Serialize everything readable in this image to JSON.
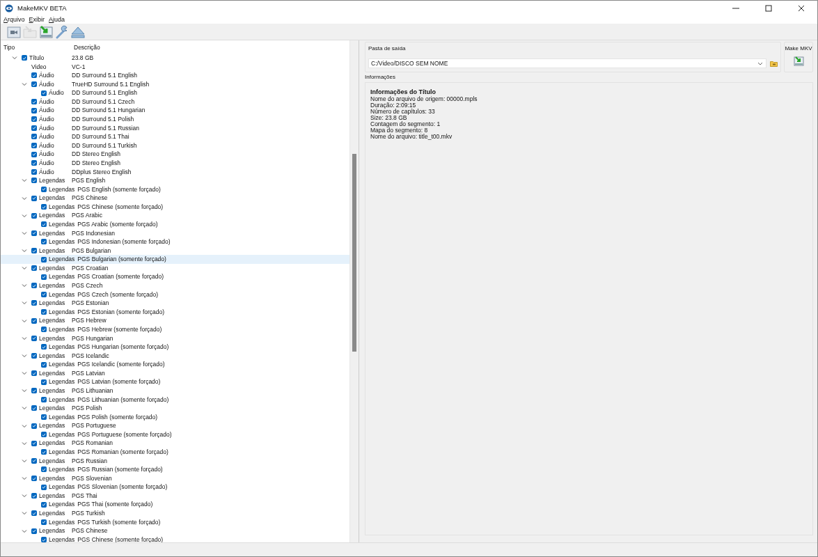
{
  "window": {
    "title": "MakeMKV BETA"
  },
  "menu": [
    {
      "label": "Arquivo"
    },
    {
      "label": "Exibir"
    },
    {
      "label": "Ajuda"
    }
  ],
  "toolbar": [
    {
      "kind": "video",
      "disabled": false
    },
    {
      "kind": "disc",
      "disabled": true
    },
    {
      "kind": "make",
      "disabled": false
    },
    {
      "kind": "wrench",
      "disabled": false
    },
    {
      "kind": "eject",
      "disabled": false
    }
  ],
  "tree": {
    "columns": [
      "Tipo",
      "Descrição"
    ],
    "items": [
      {
        "type": "Título",
        "description": "23.8 GB",
        "kind": "checkbox",
        "checked": true,
        "selected": false,
        "expanded": true,
        "children": [
          {
            "type": "Video",
            "description": "VC-1",
            "kind": "plain",
            "selected": false
          },
          {
            "type": "Áudio",
            "description": "DD Surround 5.1 English",
            "kind": "checkbox",
            "checked": true,
            "selected": false
          },
          {
            "type": "Áudio",
            "description": "TrueHD Surround 5.1 English",
            "kind": "checkbox",
            "checked": true,
            "selected": false,
            "expanded": true,
            "children": [
              {
                "type": "Áudio",
                "description": "DD Surround 5.1 English",
                "kind": "checkbox",
                "checked": true,
                "selected": false
              }
            ]
          },
          {
            "type": "Áudio",
            "description": "DD Surround 5.1 Czech",
            "kind": "checkbox",
            "checked": true,
            "selected": false
          },
          {
            "type": "Áudio",
            "description": "DD Surround 5.1 Hungarian",
            "kind": "checkbox",
            "checked": true,
            "selected": false
          },
          {
            "type": "Áudio",
            "description": "DD Surround 5.1 Polish",
            "kind": "checkbox",
            "checked": true,
            "selected": false
          },
          {
            "type": "Áudio",
            "description": "DD Surround 5.1 Russian",
            "kind": "checkbox",
            "checked": true,
            "selected": false
          },
          {
            "type": "Áudio",
            "description": "DD Surround 5.1 Thai",
            "kind": "checkbox",
            "checked": true,
            "selected": false
          },
          {
            "type": "Áudio",
            "description": "DD Surround 5.1 Turkish",
            "kind": "checkbox",
            "checked": true,
            "selected": false
          },
          {
            "type": "Áudio",
            "description": "DD Stereo English",
            "kind": "checkbox",
            "checked": true,
            "selected": false
          },
          {
            "type": "Áudio",
            "description": "DD Stereo English",
            "kind": "checkbox",
            "checked": true,
            "selected": false
          },
          {
            "type": "Áudio",
            "description": "DDplus Stereo English",
            "kind": "checkbox",
            "checked": true,
            "selected": false
          },
          {
            "type": "Legendas",
            "description": "PGS English",
            "kind": "checkbox",
            "checked": true,
            "selected": false,
            "expanded": true,
            "children": [
              {
                "type": "Legendas",
                "description": "PGS English (somente forçado)",
                "kind": "checkbox",
                "checked": true,
                "selected": false
              }
            ]
          },
          {
            "type": "Legendas",
            "description": "PGS Chinese",
            "kind": "checkbox",
            "checked": true,
            "selected": false,
            "expanded": true,
            "children": [
              {
                "type": "Legendas",
                "description": "PGS Chinese (somente forçado)",
                "kind": "checkbox",
                "checked": true,
                "selected": false
              }
            ]
          },
          {
            "type": "Legendas",
            "description": "PGS Arabic",
            "kind": "checkbox",
            "checked": true,
            "selected": false,
            "expanded": true,
            "children": [
              {
                "type": "Legendas",
                "description": "PGS Arabic (somente forçado)",
                "kind": "checkbox",
                "checked": true,
                "selected": false
              }
            ]
          },
          {
            "type": "Legendas",
            "description": "PGS Indonesian",
            "kind": "checkbox",
            "checked": true,
            "selected": false,
            "expanded": true,
            "children": [
              {
                "type": "Legendas",
                "description": "PGS Indonesian (somente forçado)",
                "kind": "checkbox",
                "checked": true,
                "selected": false
              }
            ]
          },
          {
            "type": "Legendas",
            "description": "PGS Bulgarian",
            "kind": "checkbox",
            "checked": true,
            "selected": false,
            "expanded": true,
            "children": [
              {
                "type": "Legendas",
                "description": "PGS Bulgarian (somente forçado)",
                "kind": "checkbox",
                "checked": true,
                "selected": true
              }
            ]
          },
          {
            "type": "Legendas",
            "description": "PGS Croatian",
            "kind": "checkbox",
            "checked": true,
            "selected": false,
            "expanded": true,
            "children": [
              {
                "type": "Legendas",
                "description": "PGS Croatian (somente forçado)",
                "kind": "checkbox",
                "checked": true,
                "selected": false
              }
            ]
          },
          {
            "type": "Legendas",
            "description": "PGS Czech",
            "kind": "checkbox",
            "checked": true,
            "selected": false,
            "expanded": true,
            "children": [
              {
                "type": "Legendas",
                "description": "PGS Czech (somente forçado)",
                "kind": "checkbox",
                "checked": true,
                "selected": false
              }
            ]
          },
          {
            "type": "Legendas",
            "description": "PGS Estonian",
            "kind": "checkbox",
            "checked": true,
            "selected": false,
            "expanded": true,
            "children": [
              {
                "type": "Legendas",
                "description": "PGS Estonian (somente forçado)",
                "kind": "checkbox",
                "checked": true,
                "selected": false
              }
            ]
          },
          {
            "type": "Legendas",
            "description": "PGS Hebrew",
            "kind": "checkbox",
            "checked": true,
            "selected": false,
            "expanded": true,
            "children": [
              {
                "type": "Legendas",
                "description": "PGS Hebrew (somente forçado)",
                "kind": "checkbox",
                "checked": true,
                "selected": false
              }
            ]
          },
          {
            "type": "Legendas",
            "description": "PGS Hungarian",
            "kind": "checkbox",
            "checked": true,
            "selected": false,
            "expanded": true,
            "children": [
              {
                "type": "Legendas",
                "description": "PGS Hungarian (somente forçado)",
                "kind": "checkbox",
                "checked": true,
                "selected": false
              }
            ]
          },
          {
            "type": "Legendas",
            "description": "PGS Icelandic",
            "kind": "checkbox",
            "checked": true,
            "selected": false,
            "expanded": true,
            "children": [
              {
                "type": "Legendas",
                "description": "PGS Icelandic (somente forçado)",
                "kind": "checkbox",
                "checked": true,
                "selected": false
              }
            ]
          },
          {
            "type": "Legendas",
            "description": "PGS Latvian",
            "kind": "checkbox",
            "checked": true,
            "selected": false,
            "expanded": true,
            "children": [
              {
                "type": "Legendas",
                "description": "PGS Latvian (somente forçado)",
                "kind": "checkbox",
                "checked": true,
                "selected": false
              }
            ]
          },
          {
            "type": "Legendas",
            "description": "PGS Lithuanian",
            "kind": "checkbox",
            "checked": true,
            "selected": false,
            "expanded": true,
            "children": [
              {
                "type": "Legendas",
                "description": "PGS Lithuanian (somente forçado)",
                "kind": "checkbox",
                "checked": true,
                "selected": false
              }
            ]
          },
          {
            "type": "Legendas",
            "description": "PGS Polish",
            "kind": "checkbox",
            "checked": true,
            "selected": false,
            "expanded": true,
            "children": [
              {
                "type": "Legendas",
                "description": "PGS Polish (somente forçado)",
                "kind": "checkbox",
                "checked": true,
                "selected": false
              }
            ]
          },
          {
            "type": "Legendas",
            "description": "PGS Portuguese",
            "kind": "checkbox",
            "checked": true,
            "selected": false,
            "expanded": true,
            "children": [
              {
                "type": "Legendas",
                "description": "PGS Portuguese (somente forçado)",
                "kind": "checkbox",
                "checked": true,
                "selected": false
              }
            ]
          },
          {
            "type": "Legendas",
            "description": "PGS Romanian",
            "kind": "checkbox",
            "checked": true,
            "selected": false,
            "expanded": true,
            "children": [
              {
                "type": "Legendas",
                "description": "PGS Romanian (somente forçado)",
                "kind": "checkbox",
                "checked": true,
                "selected": false
              }
            ]
          },
          {
            "type": "Legendas",
            "description": "PGS Russian",
            "kind": "checkbox",
            "checked": true,
            "selected": false,
            "expanded": true,
            "children": [
              {
                "type": "Legendas",
                "description": "PGS Russian (somente forçado)",
                "kind": "checkbox",
                "checked": true,
                "selected": false
              }
            ]
          },
          {
            "type": "Legendas",
            "description": "PGS Slovenian",
            "kind": "checkbox",
            "checked": true,
            "selected": false,
            "expanded": true,
            "children": [
              {
                "type": "Legendas",
                "description": "PGS Slovenian (somente forçado)",
                "kind": "checkbox",
                "checked": true,
                "selected": false
              }
            ]
          },
          {
            "type": "Legendas",
            "description": "PGS Thai",
            "kind": "checkbox",
            "checked": true,
            "selected": false,
            "expanded": true,
            "children": [
              {
                "type": "Legendas",
                "description": "PGS Thai (somente forçado)",
                "kind": "checkbox",
                "checked": true,
                "selected": false
              }
            ]
          },
          {
            "type": "Legendas",
            "description": "PGS Turkish",
            "kind": "checkbox",
            "checked": true,
            "selected": false,
            "expanded": true,
            "children": [
              {
                "type": "Legendas",
                "description": "PGS Turkish (somente forçado)",
                "kind": "checkbox",
                "checked": true,
                "selected": false
              }
            ]
          },
          {
            "type": "Legendas",
            "description": "PGS Chinese",
            "kind": "checkbox",
            "checked": true,
            "selected": false,
            "expanded": true,
            "children": [
              {
                "type": "Legendas",
                "description": "PGS Chinese (somente forçado)",
                "kind": "checkbox",
                "checked": true,
                "selected": false
              }
            ]
          }
        ]
      }
    ]
  },
  "output": {
    "label": "Pasta de saída",
    "value": "C:/Video/DISCO SEM NOME"
  },
  "make_mkv": {
    "label": "Make MKV"
  },
  "info": {
    "label": "Informações",
    "heading": "Informações do Título",
    "lines": [
      "Nome do arquivo de origem: 00000.mpls",
      "Duração: 2:09:15",
      "Número de capítulos: 33",
      "Size: 23.8 GB",
      "Contagem do segmento: 1",
      "Mapa do segmento: 8",
      "Nome do arquivo: title_t00.mkv"
    ]
  }
}
